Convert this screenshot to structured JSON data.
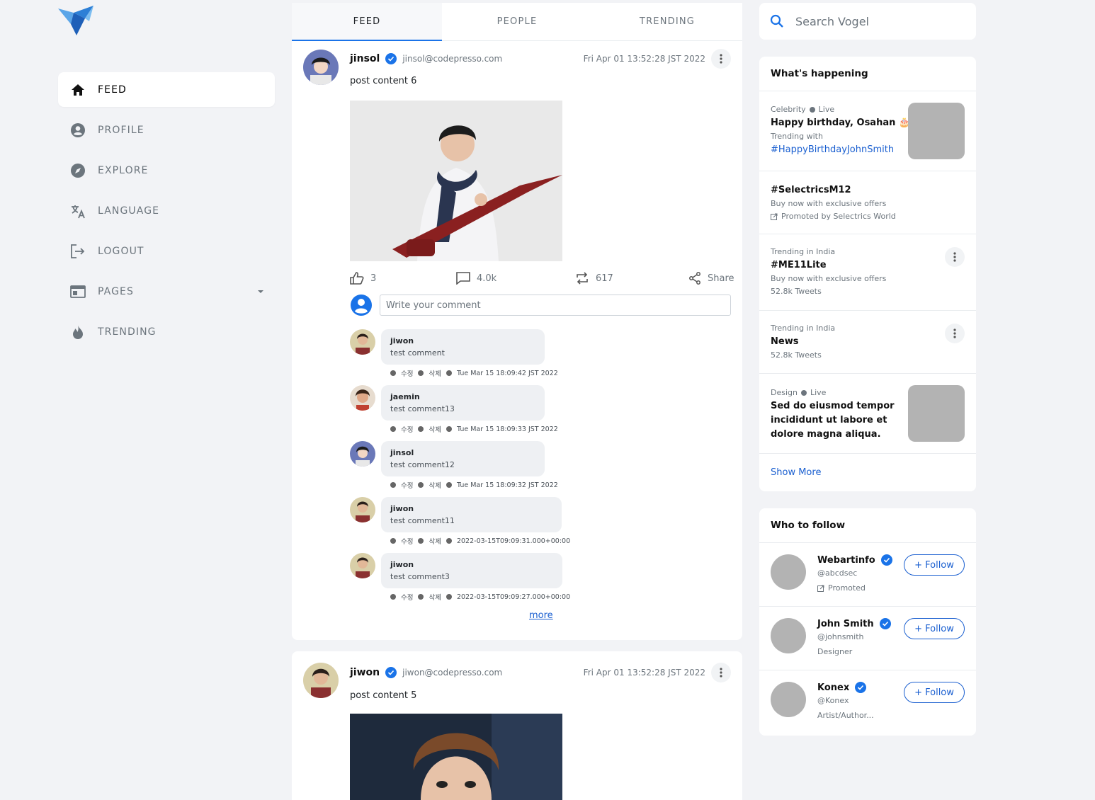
{
  "nav": {
    "items": [
      {
        "label": "FEED",
        "icon": "home-icon"
      },
      {
        "label": "PROFILE",
        "icon": "account-circle-icon"
      },
      {
        "label": "EXPLORE",
        "icon": "compass-icon"
      },
      {
        "label": "LANGUAGE",
        "icon": "translate-icon"
      },
      {
        "label": "LOGOUT",
        "icon": "logout-icon"
      },
      {
        "label": "PAGES",
        "icon": "web-page-icon"
      },
      {
        "label": "TRENDING",
        "icon": "flame-icon"
      }
    ]
  },
  "tabs": [
    "FEED",
    "PEOPLE",
    "TRENDING"
  ],
  "posts": [
    {
      "name": "jinsol",
      "email": "jinsol@codepresso.com",
      "date": "Fri Apr 01 13:52:28 JST 2022",
      "text": "post content 6",
      "likes": "3",
      "comments_count": "4.0k",
      "retweets": "617",
      "share_label": "Share",
      "comment_placeholder": "Write your comment",
      "comments": [
        {
          "name": "jiwon",
          "text": "test comment",
          "edit": "수정",
          "delete": "삭제",
          "date": "Tue Mar 15 18:09:42 JST 2022"
        },
        {
          "name": "jaemin",
          "text": "test comment13",
          "edit": "수정",
          "delete": "삭제",
          "date": "Tue Mar 15 18:09:33 JST 2022"
        },
        {
          "name": "jinsol",
          "text": "test comment12",
          "edit": "수정",
          "delete": "삭제",
          "date": "Tue Mar 15 18:09:32 JST 2022"
        },
        {
          "name": "jiwon",
          "text": "test comment11",
          "edit": "수정",
          "delete": "삭제",
          "date": "2022-03-15T09:09:31.000+00:00"
        },
        {
          "name": "jiwon",
          "text": "test comment3",
          "edit": "수정",
          "delete": "삭제",
          "date": "2022-03-15T09:09:27.000+00:00"
        }
      ],
      "more_label": "more"
    },
    {
      "name": "jiwon",
      "email": "jiwon@codepresso.com",
      "date": "Fri Apr 01 13:52:28 JST 2022",
      "text": "post content 5"
    }
  ],
  "search": {
    "placeholder": "Search Vogel"
  },
  "whats_happening": {
    "title": "What's happening",
    "items": [
      {
        "category": "Celebrity",
        "live": "Live",
        "title": "Happy birthday, Osahan 🎂",
        "sub": "Trending with",
        "link": "#HappyBirthdayJohnSmith"
      },
      {
        "title": "#SelectricsM12",
        "sub": "Buy now with exclusive offers",
        "promo": "Promoted by Selectrics World"
      },
      {
        "category": "Trending in India",
        "title": "#ME11Lite",
        "sub": "Buy now with exclusive offers",
        "count": "52.8k Tweets"
      },
      {
        "category": "Trending in India",
        "title": "News",
        "count": "52.8k Tweets"
      },
      {
        "category": "Design",
        "live": "Live",
        "title": "Sed do eiusmod tempor incididunt ut labore et dolore magna aliqua."
      }
    ],
    "show_more": "Show More"
  },
  "who_to_follow": {
    "title": "Who to follow",
    "people": [
      {
        "name": "Webartinfo",
        "handle": "@abcdsec",
        "sub": "Promoted",
        "button": "+ Follow"
      },
      {
        "name": "John Smith",
        "handle": "@johnsmith",
        "sub": "Designer",
        "button": "+ Follow"
      },
      {
        "name": "Konex",
        "handle": "@Konex",
        "sub": "Artist/Author...",
        "button": "+ Follow"
      }
    ]
  },
  "colors": {
    "accent": "#1a73e8",
    "link": "#1a5fd0",
    "background": "#f2f3f6",
    "placeholder_gray": "#b3b3b3"
  }
}
